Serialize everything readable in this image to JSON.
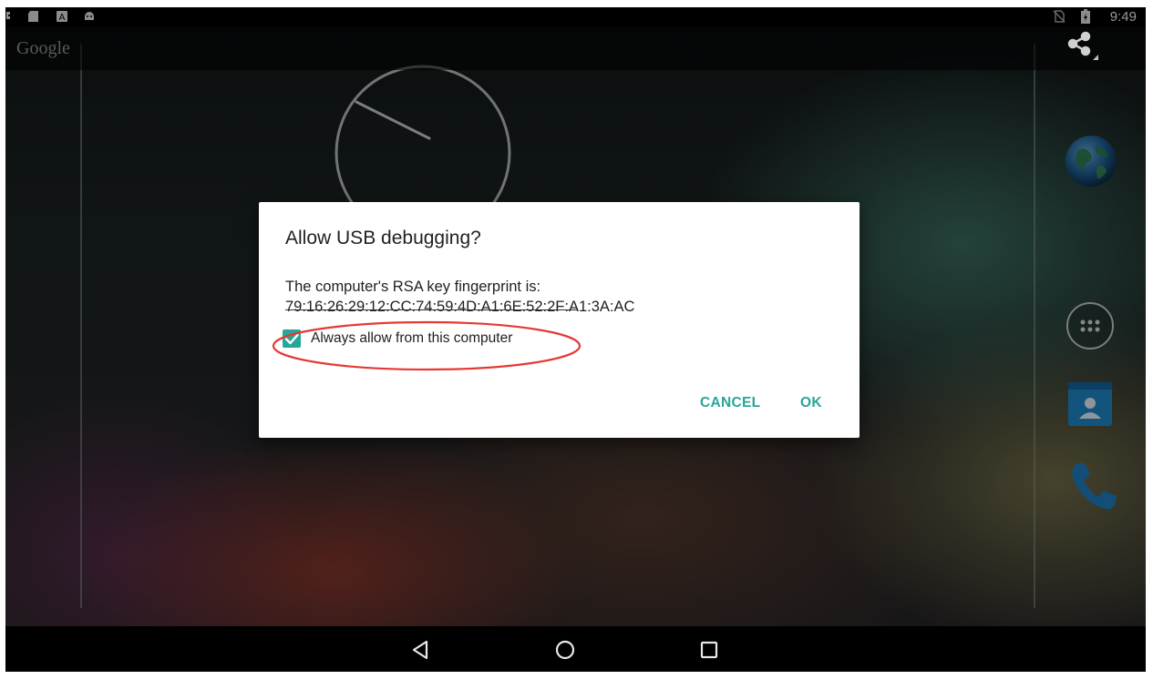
{
  "status_bar": {
    "time": "9:49"
  },
  "launcher": {
    "brand_text": "Google"
  },
  "dialog": {
    "title": "Allow USB debugging?",
    "fingerprint_label": "The computer's RSA key fingerprint is:",
    "fingerprint_value": "79:16:26:29:12:CC:74:59:4D:A1:6E:52:2F:A1:3A:AC",
    "always_allow_label": "Always allow from this computer",
    "always_allow_checked": true,
    "cancel_label": "CANCEL",
    "ok_label": "OK",
    "accent_color": "#26a69a",
    "annotation_color": "#e53935"
  },
  "icons": {
    "status_bar": [
      "notification-icon",
      "sd-card-icon",
      "keyboard-icon",
      "android-icon",
      "no-sim-icon",
      "battery-charging-icon"
    ],
    "action_bar": [
      "share-icon"
    ],
    "home": [
      "analog-clock",
      "globe-icon",
      "app-drawer-icon",
      "contacts-icon",
      "phone-icon"
    ],
    "nav_bar": [
      "back-icon",
      "home-icon",
      "recents-icon"
    ]
  }
}
